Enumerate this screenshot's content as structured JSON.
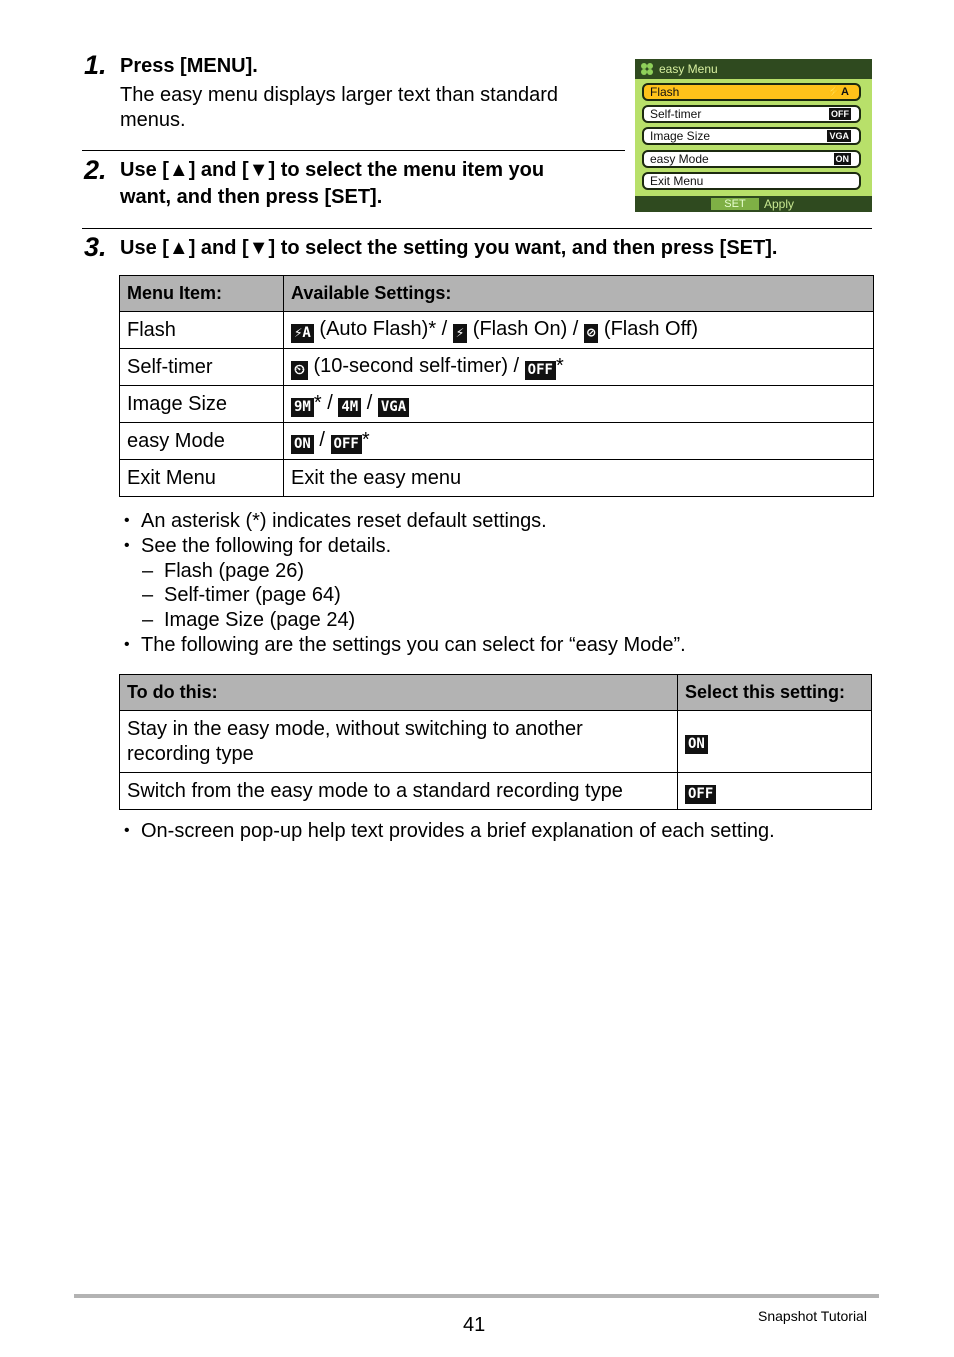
{
  "steps": [
    {
      "number": "1.",
      "title": "Press [MENU].",
      "body": "The easy menu displays larger text than standard menus."
    },
    {
      "number": "2.",
      "title_line1": "Use [▲] and [▼] to select the menu item you",
      "title_line2": "want, and then press [SET]."
    },
    {
      "number": "3.",
      "title": "Use [▲] and [▼] to select the setting you want, and then press [SET]."
    }
  ],
  "camera_screen": {
    "header": "easy Menu",
    "header_icon": "clover-icon",
    "items": [
      {
        "label": "Flash",
        "value": "⚡A",
        "selected": true
      },
      {
        "label": "Self-timer",
        "value": "OFF",
        "selected": false
      },
      {
        "label": "Image Size",
        "value": "VGA",
        "selected": false
      },
      {
        "label": "easy Mode",
        "value": "ON",
        "selected": false
      },
      {
        "label": "Exit Menu",
        "value": "",
        "selected": false
      }
    ],
    "footer_set": "SET",
    "footer_apply": "Apply",
    "colors": {
      "background": "#b8e06a",
      "bar": "#2f4a1f",
      "selected": "#ffc21a"
    }
  },
  "settings_table": {
    "headers": [
      "Menu Item:",
      "Available Settings:"
    ],
    "rows": [
      {
        "item": "Flash",
        "parts": [
          {
            "icon": "auto-flash-icon",
            "glyph": "⚡A",
            "text": " (Auto Flash)* / "
          },
          {
            "icon": "flash-on-icon",
            "glyph": "⚡",
            "text": " (Flash On) / "
          },
          {
            "icon": "flash-off-icon",
            "glyph": "⊘",
            "text": " (Flash Off)"
          }
        ]
      },
      {
        "item": "Self-timer",
        "parts": [
          {
            "icon": "self-timer-icon",
            "glyph": "⏲",
            "text": " (10-second self-timer) / "
          },
          {
            "icon": "off-icon",
            "glyph": "OFF",
            "text": "*"
          }
        ]
      },
      {
        "item": "Image Size",
        "parts": [
          {
            "icon": "9m-icon",
            "glyph": "9M",
            "text": "* / "
          },
          {
            "icon": "4m-icon",
            "glyph": "4M",
            "text": " / "
          },
          {
            "icon": "vga-icon",
            "glyph": "VGA",
            "text": ""
          }
        ]
      },
      {
        "item": "easy Mode",
        "parts": [
          {
            "icon": "on-icon",
            "glyph": "ON",
            "text": " / "
          },
          {
            "icon": "off-icon",
            "glyph": "OFF",
            "text": "*"
          }
        ]
      },
      {
        "item": "Exit Menu",
        "parts": [
          {
            "icon": "",
            "glyph": "",
            "text": "Exit the easy menu"
          }
        ]
      }
    ]
  },
  "notes": {
    "bullet1": "An asterisk (*) indicates reset default settings.",
    "bullet2": "See the following for details.",
    "sub1": "Flash (page 26)",
    "sub2": "Self-timer (page 64)",
    "sub3": "Image Size (page 24)",
    "bullet3": "The following are the settings you can select for “easy Mode”."
  },
  "mode_table": {
    "headers": [
      "To do this:",
      "Select this setting:"
    ],
    "rows": [
      {
        "action_line1": "Stay in the easy mode, without switching to another",
        "action_line2": "recording type",
        "setting": "ON"
      },
      {
        "action_line1": "Switch from the easy mode to a standard recording type",
        "action_line2": "",
        "setting": "OFF"
      }
    ]
  },
  "final_note": "On-screen pop-up help text provides a brief explanation of each setting.",
  "footer": {
    "page_number": "41",
    "section": "Snapshot Tutorial"
  }
}
